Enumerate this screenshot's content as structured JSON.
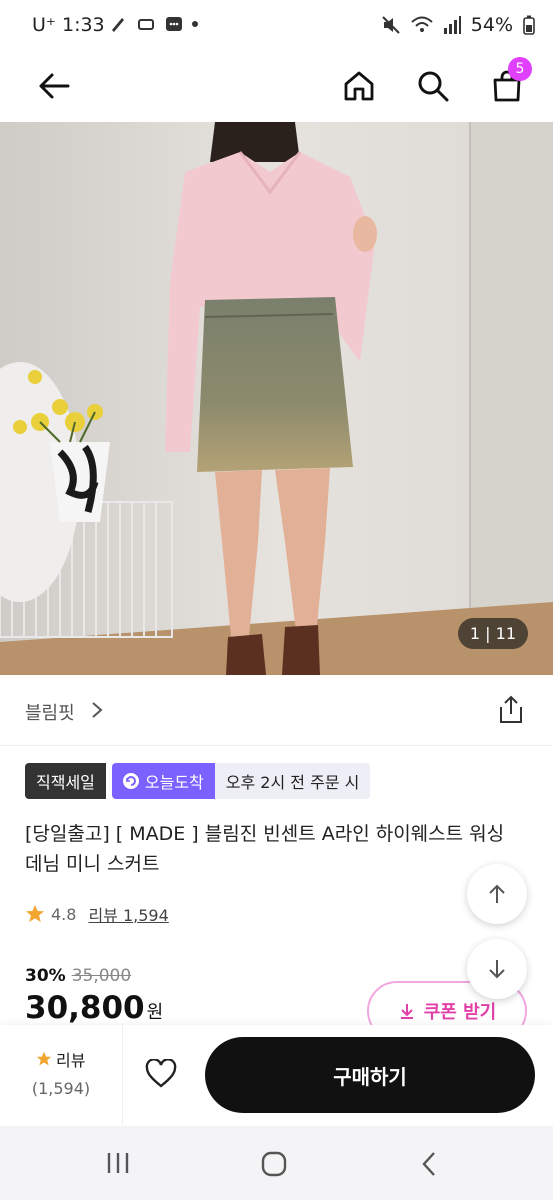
{
  "status_bar": {
    "carrier": "U⁺ 1:33",
    "battery": "54%"
  },
  "nav": {
    "cart_count": "5"
  },
  "hero": {
    "image_counter": "1 | 11"
  },
  "brand": {
    "name": "블림핏"
  },
  "tags": {
    "sale": "직잭세일",
    "arrival": "오늘도착",
    "arrival_note": "오후 2시 전 주문 시"
  },
  "product": {
    "title": "[당일출고] [ MADE ] 블림진 빈센트 A라인 하이웨스트 워싱 데님 미니 스커트",
    "rating": "4.8",
    "review_link": "리뷰 1,594",
    "discount": "30%",
    "original_price": "35,000",
    "price": "30,800",
    "currency": "원"
  },
  "coupon": {
    "label": "쿠폰 받기"
  },
  "bottom": {
    "review_label": "리뷰",
    "review_count": "(1,594)",
    "buy_label": "구매하기"
  },
  "colors": {
    "accent_pink": "#e040fb",
    "purple_tag": "#7b61ff",
    "buy_button": "#111111"
  }
}
